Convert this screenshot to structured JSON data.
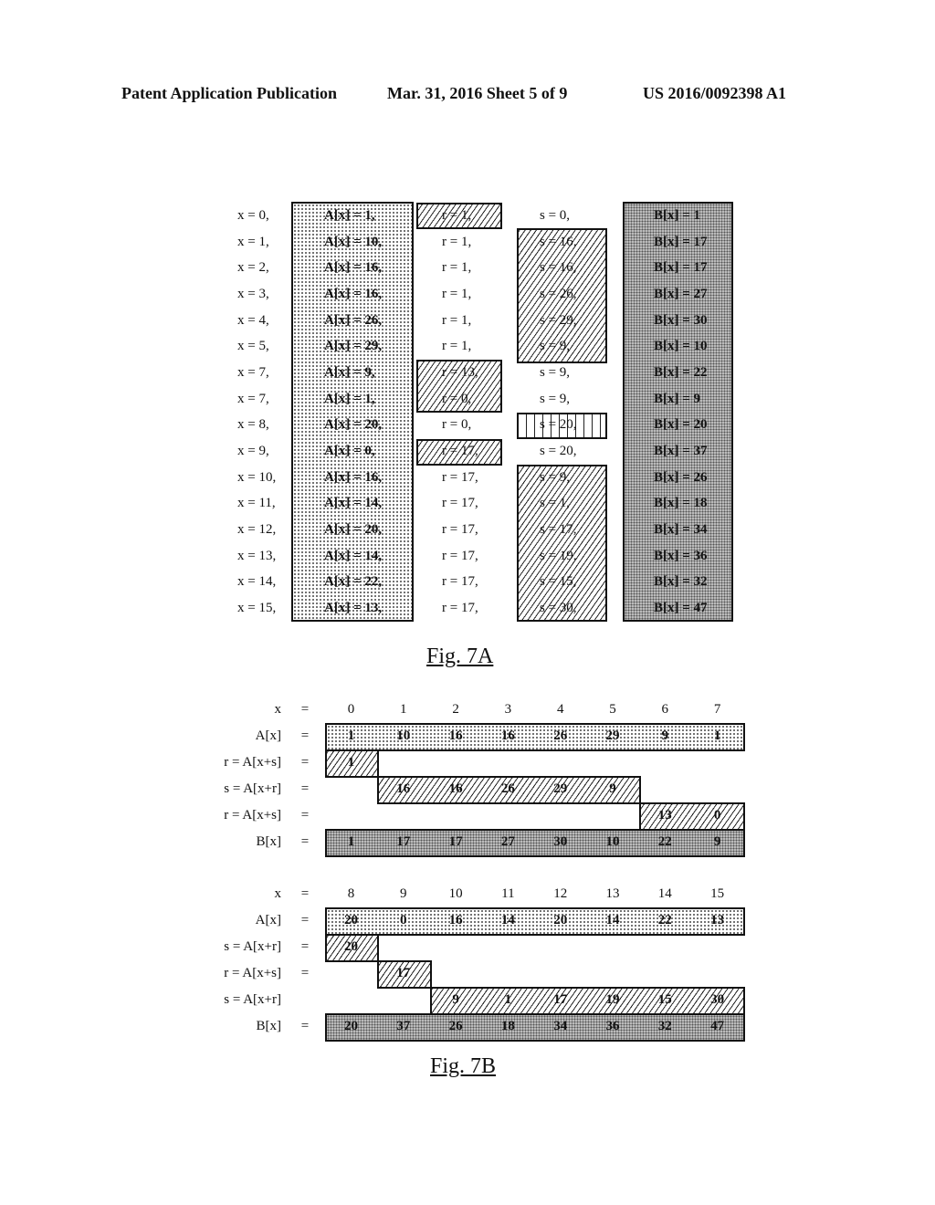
{
  "header": {
    "left": "Patent Application Publication",
    "middle": "Mar. 31, 2016  Sheet 5 of 9",
    "right": "US 2016/0092398 A1"
  },
  "fig7a": {
    "caption": "Fig. 7A",
    "rows": [
      {
        "x": "x = 0,",
        "a": "A[x] = 1,",
        "r": "r = 1,",
        "s": "s = 0,",
        "b": "B[x] = 1"
      },
      {
        "x": "x = 1,",
        "a": "A[x] = 10,",
        "r": "r = 1,",
        "s": "s = 16,",
        "b": "B[x] = 17"
      },
      {
        "x": "x = 2,",
        "a": "A[x] = 16,",
        "r": "r = 1,",
        "s": "s = 16,",
        "b": "B[x] = 17"
      },
      {
        "x": "x = 3,",
        "a": "A[x] = 16,",
        "r": "r = 1,",
        "s": "s = 26,",
        "b": "B[x] = 27"
      },
      {
        "x": "x = 4,",
        "a": "A[x] = 26,",
        "r": "r = 1,",
        "s": "s = 29,",
        "b": "B[x] = 30"
      },
      {
        "x": "x = 5,",
        "a": "A[x] = 29,",
        "r": "r = 1,",
        "s": "s = 9,",
        "b": "B[x] = 10"
      },
      {
        "x": "x = 7,",
        "a": "A[x] = 9,",
        "r": "r = 13,",
        "s": "s = 9,",
        "b": "B[x] = 22"
      },
      {
        "x": "x = 7,",
        "a": "A[x] = 1,",
        "r": "r = 0,",
        "s": "s = 9,",
        "b": "B[x] = 9"
      },
      {
        "x": "x = 8,",
        "a": "A[x] = 20,",
        "r": "r = 0,",
        "s": "s = 20,",
        "b": "B[x] = 20"
      },
      {
        "x": "x = 9,",
        "a": "A[x] = 0,",
        "r": "r = 17,",
        "s": "s = 20,",
        "b": "B[x] = 37"
      },
      {
        "x": "x = 10,",
        "a": "A[x] = 16,",
        "r": "r = 17,",
        "s": "s = 9,",
        "b": "B[x] = 26"
      },
      {
        "x": "x = 11,",
        "a": "A[x] = 14,",
        "r": "r = 17,",
        "s": "s = 1,",
        "b": "B[x] = 18"
      },
      {
        "x": "x = 12,",
        "a": "A[x] = 20,",
        "r": "r = 17,",
        "s": "s = 17,",
        "b": "B[x] = 34"
      },
      {
        "x": "x = 13,",
        "a": "A[x] = 14,",
        "r": "r = 17,",
        "s": "s = 19,",
        "b": "B[x] = 36"
      },
      {
        "x": "x = 14,",
        "a": "A[x] = 22,",
        "r": "r = 17,",
        "s": "s = 15,",
        "b": "B[x] = 32"
      },
      {
        "x": "x = 15,",
        "a": "A[x] = 13,",
        "r": "r = 17,",
        "s": "s = 30,",
        "b": "B[x] = 47"
      }
    ]
  },
  "fig7b": {
    "caption": "Fig. 7B",
    "eq": "=",
    "tables": [
      {
        "x_label": "x",
        "x": [
          "0",
          "1",
          "2",
          "3",
          "4",
          "5",
          "6",
          "7"
        ],
        "rows": [
          {
            "label": "A[x]",
            "eq": "=",
            "values": [
              "1",
              "10",
              "16",
              "16",
              "26",
              "29",
              "9",
              "1"
            ]
          },
          {
            "label": "r = A[x+s]",
            "eq": "=",
            "values": [
              "1"
            ]
          },
          {
            "label": "s = A[x+r]",
            "eq": "=",
            "values": [
              "16",
              "16",
              "26",
              "29",
              "9"
            ]
          },
          {
            "label": "r = A[x+s]",
            "eq": "=",
            "values": [
              "13",
              "0"
            ]
          },
          {
            "label": "B[x]",
            "eq": "=",
            "values": [
              "1",
              "17",
              "17",
              "27",
              "30",
              "10",
              "22",
              "9"
            ]
          }
        ]
      },
      {
        "x_label": "x",
        "x": [
          "8",
          "9",
          "10",
          "11",
          "12",
          "13",
          "14",
          "15"
        ],
        "rows": [
          {
            "label": "A[x]",
            "eq": "=",
            "values": [
              "20",
              "0",
              "16",
              "14",
              "20",
              "14",
              "22",
              "13"
            ]
          },
          {
            "label": "s = A[x+r]",
            "eq": "=",
            "values": [
              "20"
            ]
          },
          {
            "label": "r = A[x+s]",
            "eq": "=",
            "values": [
              "17"
            ]
          },
          {
            "label": "s = A[x+r]",
            "eq": "",
            "values": [
              "9",
              "1",
              "17",
              "19",
              "15",
              "30"
            ]
          },
          {
            "label": "B[x]",
            "eq": "=",
            "values": [
              "20",
              "37",
              "26",
              "18",
              "34",
              "36",
              "32",
              "47"
            ]
          }
        ]
      }
    ]
  }
}
